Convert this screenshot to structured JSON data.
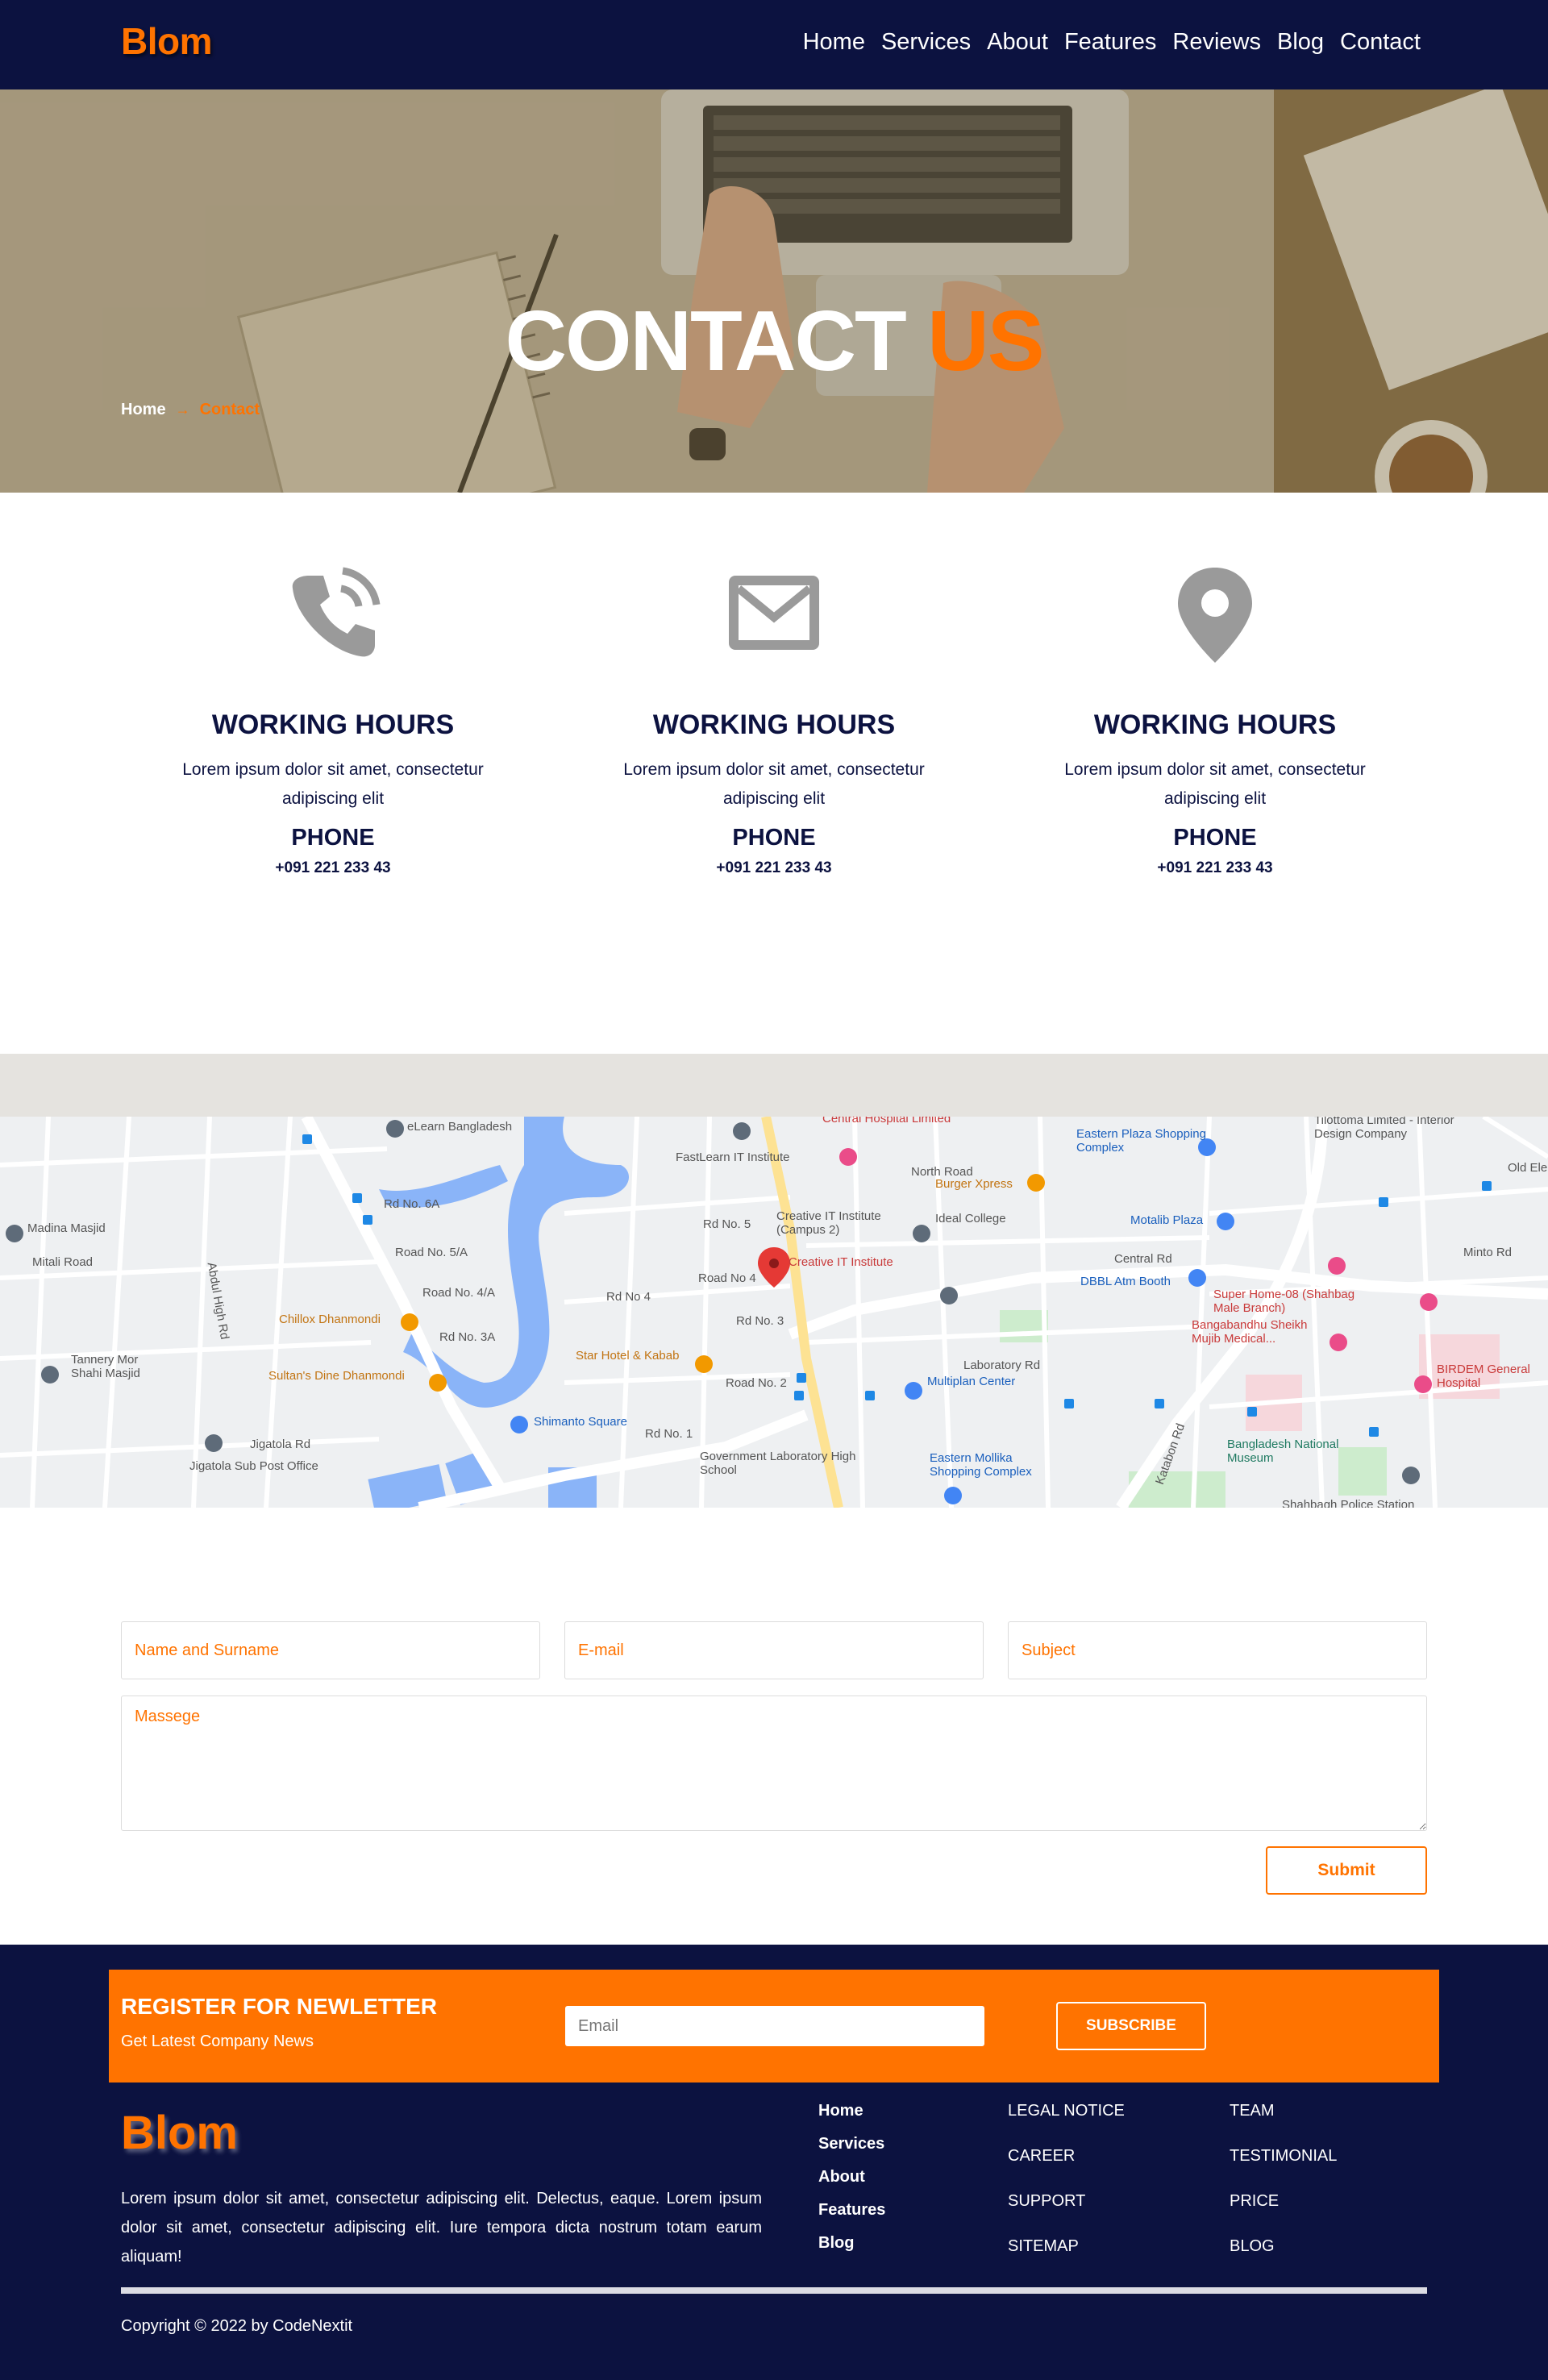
{
  "brand": "Blom",
  "nav": {
    "items": [
      "Home",
      "Services",
      "About",
      "Features",
      "Reviews",
      "Blog",
      "Contact"
    ]
  },
  "hero": {
    "title_main": "CONTACT",
    "title_accent": "US",
    "breadcrumb_home": "Home",
    "breadcrumb_sep": "→",
    "breadcrumb_current": "Contact"
  },
  "cards": [
    {
      "icon": "phone-icon",
      "title": "WORKING HOURS",
      "text": "Lorem ipsum dolor sit amet, consectetur adipiscing elit",
      "label": "PHONE",
      "number": "+091 221 233 43"
    },
    {
      "icon": "envelope-icon",
      "title": "WORKING HOURS",
      "text": "Lorem ipsum dolor sit amet, consectetur adipiscing elit",
      "label": "PHONE",
      "number": "+091 221 233 43"
    },
    {
      "icon": "map-pin-icon",
      "title": "WORKING HOURS",
      "text": "Lorem ipsum dolor sit amet, consectetur adipiscing elit",
      "label": "PHONE",
      "number": "+091 221 233 43"
    }
  ],
  "map": {
    "labels": {
      "elearn": "eLearn Bangladesh",
      "fastlearn": "FastLearn IT Institute",
      "central_hospital": "Central Hospital Limited",
      "burger": "Burger Xpress",
      "creative_campus": "Creative IT Institute (Campus 2)",
      "ideal": "Ideal College",
      "creative": "Creative IT Institute",
      "eastern_plaza": "Eastern Plaza Shopping Complex",
      "tilottoma": "Tilottoma Limited - Interior Design Company",
      "motalib": "Motalib Plaza",
      "dbbl": "DBBL Atm Booth",
      "super_home": "Super Home-08 (Shahbag Male Branch)",
      "bsmmu": "Bangabandhu Sheikh Mujib Medical...",
      "birdem": "BIRDEM General Hospital",
      "madina": "Madina Masjid",
      "chillox": "Chillox Dhanmondi",
      "sultans": "Sultan's Dine Dhanmondi",
      "star": "Star Hotel & Kabab",
      "tannery": "Tannery Mor Shahi Masjid",
      "shimanto": "Shimanto Square",
      "jigatola_po": "Jigatola Sub Post Office",
      "govt_lab": "Government Laboratory High School",
      "multiplan": "Multiplan Center",
      "eastern_mollika": "Eastern Mollika Shopping Complex",
      "museum": "Bangladesh National Museum",
      "shahbagh_police": "Shahbagh Police Station",
      "north_road": "North Road",
      "rd6a": "Rd No. 6A",
      "rd5a": "Road No. 5/A",
      "rd4a": "Road No. 4/A",
      "rd3a": "Rd No. 3A",
      "rd4": "Rd No 4",
      "road4": "Road No 4",
      "rd5": "Rd No. 5",
      "rd3": "Rd No. 3",
      "road2": "Road No. 2",
      "rd1": "Rd No. 1",
      "central_rd": "Central Rd",
      "minto_rd": "Minto Rd",
      "laboratory_rd": "Laboratory Rd",
      "jigatola_rd": "Jigatola Rd",
      "mitali_road": "Mitali Road",
      "abdul_high": "Abdul High Rd",
      "katabon": "Katabon Rd",
      "old_elephant": "Old Elep"
    }
  },
  "form": {
    "name_placeholder": "Name and Surname",
    "email_placeholder": "E-mail",
    "subject_placeholder": "Subject",
    "message_placeholder": "Massege",
    "submit_label": "Submit"
  },
  "newsletter": {
    "title": "REGISTER FOR NEWLETTER",
    "subtitle": "Get Latest Company News",
    "email_placeholder": "Email",
    "button_label": "SUBSCRIBE"
  },
  "footer": {
    "brand": "Blom",
    "about": "Lorem ipsum dolor sit amet, consectetur adipiscing elit. Delectus, eaque. Lorem ipsum dolor sit amet, consectetur adipiscing elit. Iure tempora dicta nostrum totam earum aliquam!",
    "nav_links": [
      "Home",
      "Services",
      "About",
      "Features",
      "Blog"
    ],
    "col2": [
      "LEGAL NOTICE",
      "CAREER",
      "SUPPORT",
      "SITEMAP"
    ],
    "col3": [
      "TEAM",
      "TESTIMONIAL",
      "PRICE",
      "BLOG"
    ],
    "copyright": "Copyright © 2022 by CodeNextit"
  },
  "colors": {
    "navy": "#0c1240",
    "orange": "#ff7300",
    "icon_gray": "#9a9a9a"
  }
}
